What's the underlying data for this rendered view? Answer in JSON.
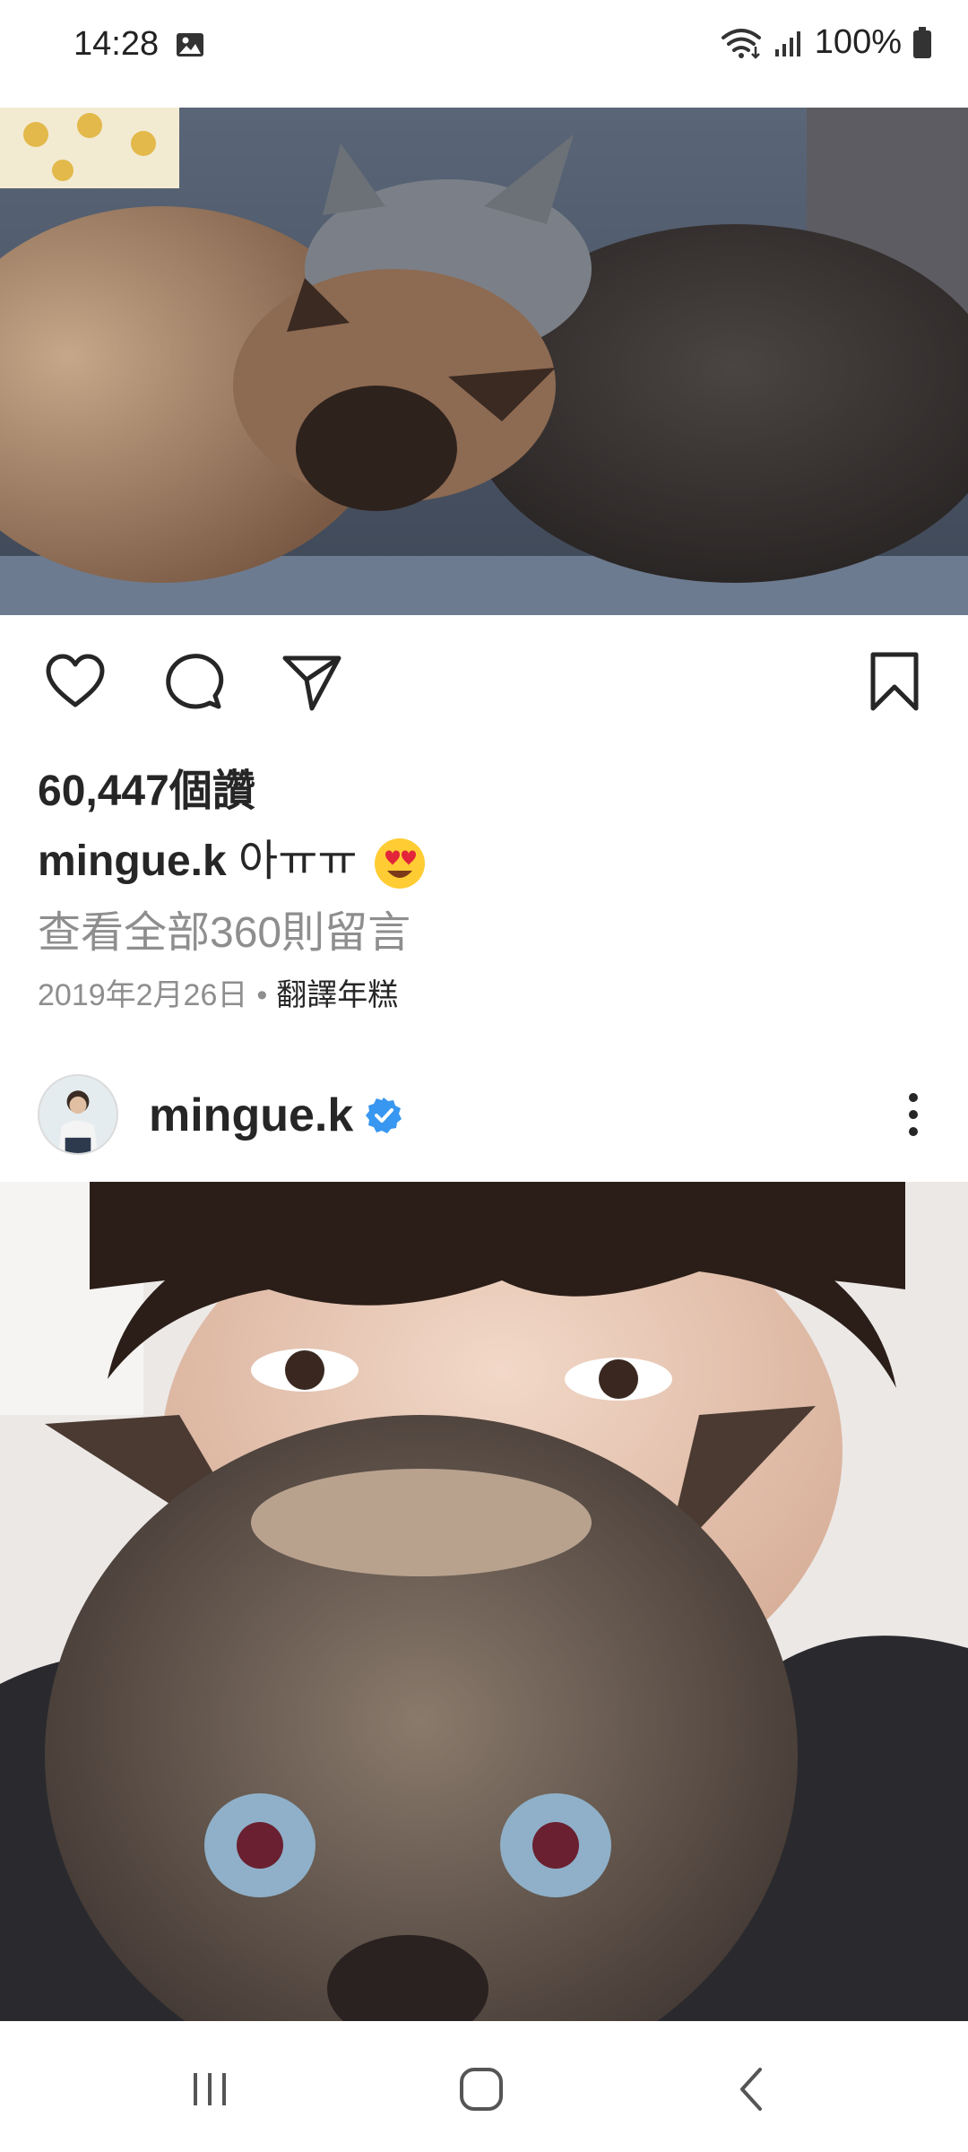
{
  "status_bar": {
    "time": "14:28",
    "battery": "100%",
    "icons": [
      "gallery-icon",
      "wifi-icon",
      "signal-icon",
      "battery-icon"
    ]
  },
  "post1": {
    "image_description_icon": "cats-photo",
    "likes": "60,447個讚",
    "caption_user": "mingue.k",
    "caption_text": "아ㅠㅠ",
    "caption_emoji": "smiling-face-with-heart-eyes",
    "view_comments": "查看全部360則留言",
    "date": "2019年2月26日",
    "separator": "•",
    "translate": "翻譯年糕"
  },
  "post2": {
    "username": "mingue.k",
    "verified": true,
    "more_icon": "more-vertical-icon"
  },
  "actions": {
    "icons": [
      "heart-icon",
      "comment-icon",
      "share-icon",
      "bookmark-icon"
    ]
  },
  "nav": {
    "icons": [
      "recent-apps-icon",
      "home-icon",
      "back-icon"
    ]
  },
  "colors": {
    "text": "#262626",
    "secondary": "#8e8e8e",
    "verified": "#3897f0"
  }
}
